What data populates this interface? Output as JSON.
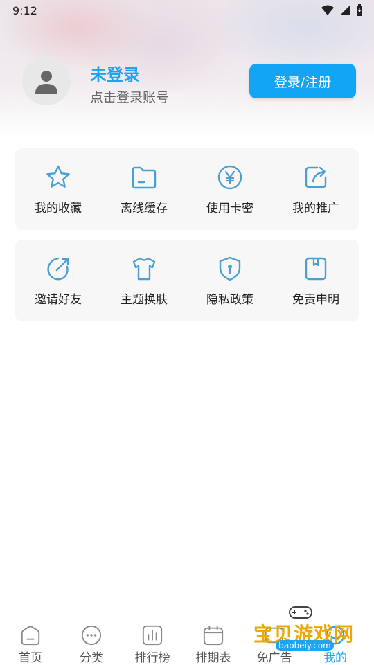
{
  "status_bar": {
    "time": "9:12"
  },
  "profile": {
    "name": "未登录",
    "subtitle": "点击登录账号",
    "login_button": "登录/注册"
  },
  "grid_row1": [
    {
      "label": "我的收藏",
      "icon": "star-icon"
    },
    {
      "label": "离线缓存",
      "icon": "folder-icon"
    },
    {
      "label": "使用卡密",
      "icon": "yen-coin-icon"
    },
    {
      "label": "我的推广",
      "icon": "share-icon"
    }
  ],
  "grid_row2": [
    {
      "label": "邀请好友",
      "icon": "invite-arrow-icon"
    },
    {
      "label": "主题换肤",
      "icon": "tshirt-icon"
    },
    {
      "label": "隐私政策",
      "icon": "shield-icon"
    },
    {
      "label": "免责申明",
      "icon": "bookmark-icon"
    }
  ],
  "tabbar": [
    {
      "label": "首页",
      "icon": "home-icon"
    },
    {
      "label": "分类",
      "icon": "more-dots-icon"
    },
    {
      "label": "排行榜",
      "icon": "bar-chart-icon"
    },
    {
      "label": "排期表",
      "icon": "calendar-icon"
    },
    {
      "label": "免广告",
      "icon": "no-ads-icon"
    },
    {
      "label": "我的",
      "icon": "profile-icon"
    }
  ],
  "watermark": {
    "text": "宝贝游戏网",
    "url": "baobeiy.com"
  },
  "colors": {
    "accent": "#1ea5f0",
    "button": "#12a4f5",
    "icon": "#4a9fd4"
  }
}
